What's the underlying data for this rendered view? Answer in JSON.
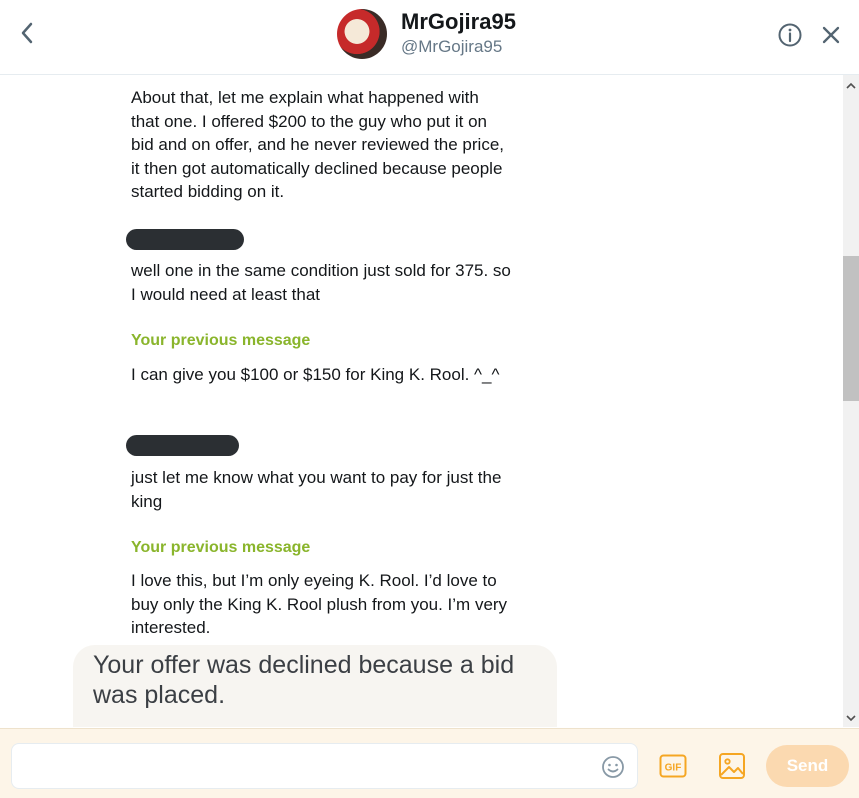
{
  "header": {
    "name": "MrGojira95",
    "handle": "@MrGojira95"
  },
  "thread": {
    "messages": [
      "About that, let me explain what happened with that one. I offered $200 to the guy who put it on bid and on offer, and he never reviewed the price, it then got automatically declined because people started bidding on it.",
      "well one in the same condition just sold for 375. so I would need at least that",
      "I can give you $100 or $150 for King K. Rool. ^_^",
      "just let me know what you want to pay for just the king",
      "I love this, but I’m only eyeing K. Rool. I’d love to buy only the King K. Rool plush from you. I’m very interested."
    ],
    "previous_label": "Your previous message",
    "system_notice": "Your offer was declined because a bid was placed."
  },
  "composer": {
    "input_value": "",
    "gif_label": "GIF",
    "send_label": "Send"
  },
  "colors": {
    "accent": "#8ab52c",
    "send_disabled": "#fbd9b0",
    "icon": "#f5a623"
  }
}
